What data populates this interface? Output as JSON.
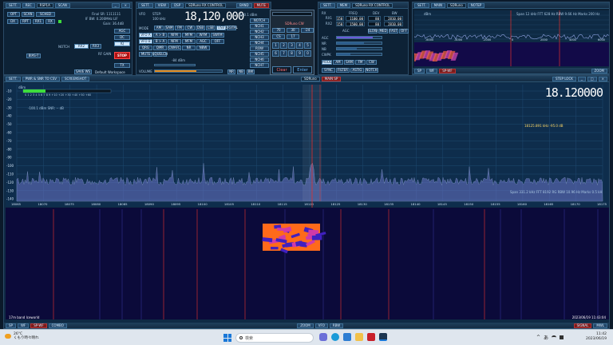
{
  "top_left": {
    "tabs": [
      "SETT.",
      "REC",
      "SCAN"
    ],
    "title": "RSP1A",
    "devcount": "RSP1A",
    "buttons": [
      "OPT",
      "SCAN",
      "SCHED",
      "DX",
      "RPT",
      "RX1",
      "RX",
      "RX2",
      "RX3",
      "RX4",
      "CAT"
    ],
    "info": [
      "Final SR: 1111111",
      "IF BW: 0.200MHz LIF",
      "Gain: 36.4dB"
    ],
    "rbtn": [
      "AGC",
      "DC",
      "IQ",
      "TX",
      "NOTCH"
    ],
    "bias": "BIAS-T",
    "rfgain": "RF GAIN",
    "stop": "STOP",
    "workspace": "Default Workspace",
    "save": "SAVE WS"
  },
  "rx_control": {
    "tabs": [
      "SETT.",
      "VIEW",
      "DSP"
    ],
    "title": "SDRuno RX CONTROL",
    "band_tabs": [
      "BAND",
      "MUTE"
    ],
    "freq": "18,120,000",
    "freq_label": "VFO",
    "step": "STEP:",
    "step_val": "100 kHz",
    "level": "-100.1 dBm",
    "mode_label": "MODE",
    "modes": [
      "AM",
      "SAM",
      "FM",
      "CW",
      "DSB",
      "LSB",
      "USB",
      "DIGITAL"
    ],
    "row2": [
      "VFO A",
      "A > B",
      "NFM",
      "MFM",
      "WFM",
      "SWFM"
    ],
    "row3": [
      "VFO B",
      "B > A",
      "NFM",
      "MFM",
      "AGC",
      "OFF"
    ],
    "row4": [
      "QRG",
      "QMR",
      "CWAFC",
      "NR",
      "NBW"
    ],
    "row5": [
      "MUTE",
      "SQUELCH"
    ],
    "squelch_val": "-84 dBm",
    "volume": "VOLUME",
    "rbtns": [
      "NOTCH",
      "NCH1",
      "NCH2",
      "NCH3",
      "NCH4",
      "ROW",
      "NCH5",
      "NCH6",
      "NCH7"
    ],
    "dsp": [
      "NR",
      "NB",
      "BW"
    ],
    "cs_vals": [
      "70",
      "30",
      "-24",
      "CS",
      "17"
    ],
    "ms_title": "SDRuno CW",
    "ms_keys": [
      "1",
      "2",
      "3",
      "4",
      "5",
      "6",
      "7",
      "8",
      "9",
      "0",
      "Clear",
      "Enter"
    ]
  },
  "rx_ctrl2": {
    "tabs": [
      "SETT.",
      "MEM"
    ],
    "title": "SDRuno RX CONTROL",
    "headers": [
      "RX",
      "FREQ",
      "DEV",
      "BW"
    ],
    "rows": [
      [
        "RX1",
        "150",
        "1100.00",
        "80",
        "2810.00"
      ],
      [
        "RX2",
        "150",
        "1500.00",
        "80",
        "2810.00"
      ]
    ],
    "agc_label": "AGC",
    "agc_btns": [
      "SLOW",
      "MED",
      "FAST",
      "OFF"
    ],
    "labels": [
      "AGC",
      "NR",
      "NB",
      "CWPK"
    ],
    "mode_btns": [
      "MODE",
      "AM",
      "SAM",
      "FM",
      "CW"
    ],
    "lower": [
      "SYNC",
      "FILTER",
      "ASTIG",
      "NOTCH"
    ]
  },
  "spectrum_mini": {
    "tabs": [
      "SETT.",
      "MAIN"
    ],
    "title": "SDRuno",
    "sub": "NOTEP",
    "info": "Span 12 kHz  FFT 628 Hz  RBW 9.66 Hz  Marks 200 Hz",
    "top_level": "dBm",
    "x_ticks": [
      "-6000",
      "-4000",
      "-2000",
      "0",
      "2000",
      "4000",
      "6000"
    ],
    "bottom": [
      "SP",
      "WF",
      "SP-WF"
    ],
    "zoom": "ZOOM"
  },
  "main_sp": {
    "tabs": [
      "SETT.",
      "FREQ"
    ],
    "btns": [
      "PWR & SNR TO CSV",
      "SCREENSHOT"
    ],
    "title": "SDRuno",
    "sub": "MAIN SP",
    "step_lock": "STEP LOCK",
    "big_freq": "18.120000",
    "y_ticks": [
      "-10",
      "-20",
      "-30",
      "-40",
      "-50",
      "-60",
      "-70",
      "-80",
      "-90",
      "-100",
      "-110",
      "-120",
      "-130",
      "-140"
    ],
    "y_label": "dBm",
    "meter_scale": "S 1 2 3 4 5 6 7 8 9 +10 +20 +30 +40 +50 +60",
    "meter_reading": "-100.1 dBm  SNR: -- dB",
    "cursor_readout": "18125.891 kHz  -95.0 dB",
    "span_info": "Span 331.2 kHz  FFT 8192  RG  RBW 10.96 Hz  Marks 0.5 kH",
    "x_ticks": [
      "18065",
      "18070",
      "18075",
      "18080",
      "18085",
      "18090",
      "18095",
      "18100",
      "18105",
      "18110",
      "18115",
      "18120",
      "18125",
      "18130",
      "18135",
      "18140",
      "18145",
      "18150",
      "18155",
      "18160",
      "18165",
      "18170",
      "18175"
    ],
    "band_name": "17m band Iceworld",
    "timestamp": "2023/06/19 11:43:04",
    "bottom_tabs": [
      "SP",
      "WF",
      "SP-WF",
      "COMBO"
    ],
    "zoom": "ZOOM",
    "vfo": "VFO",
    "rbw": "RBW",
    "right_btns": [
      "SIGNAL",
      "MWL"
    ]
  },
  "taskbar": {
    "weather_temp": "26°C",
    "weather_desc": "くもり時々晴れ",
    "search_placeholder": "検索",
    "time": "11:42",
    "date": "2023/06/19",
    "ime": "あ"
  },
  "colors": {
    "bg": "#0b1a2a",
    "panel": "#0d2236",
    "accent": "#4a7ea8",
    "trace": "#8fa2e0",
    "wf": "#0b0a3a",
    "red_marker": "#e03030"
  }
}
